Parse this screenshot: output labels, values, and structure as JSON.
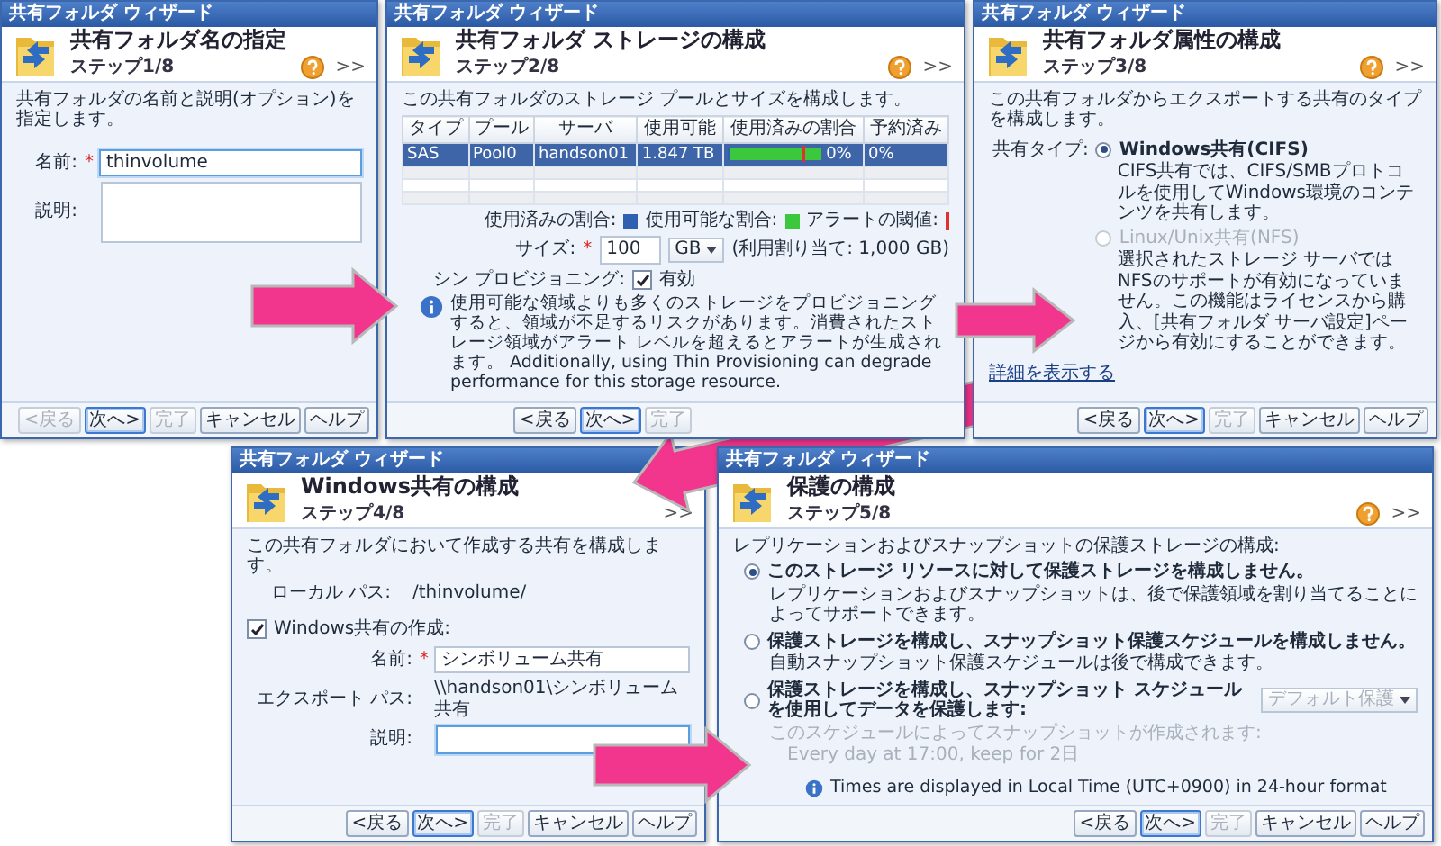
{
  "windows": [
    {
      "kind": "name",
      "title_bar": "共有フォルダ ウィザード",
      "heading": "共有フォルダ名の指定",
      "step": "ステップ1/8",
      "help_icon": true,
      "expand": ">>",
      "description": "共有フォルダの名前と説明(オプション)を指定します。",
      "rows": [
        {
          "kind": "input",
          "label": "名前:",
          "marker": "*",
          "value": "thinvolume",
          "focused": true
        },
        {
          "kind": "area",
          "label": "説明:",
          "focused": false
        }
      ],
      "buttons": [
        {
          "label": "<戻る",
          "disabled": true,
          "default": false
        },
        {
          "label": "次へ>",
          "disabled": false,
          "default": true
        },
        {
          "label": "完了",
          "disabled": true,
          "default": false
        },
        {
          "label": "キャンセル",
          "disabled": false,
          "default": false
        },
        {
          "label": "ヘルプ",
          "disabled": false,
          "default": false
        }
      ]
    },
    {
      "kind": "storage",
      "title_bar": "共有フォルダ ウィザード",
      "heading": "共有フォルダ ストレージの構成",
      "step": "ステップ2/8",
      "help_icon": true,
      "expand": ">>",
      "description": "この共有フォルダのストレージ プールとサイズを構成します。",
      "table": {
        "columns": [
          "タイプ",
          "プール",
          "サーバ",
          "使用可能",
          "使用済みの割合",
          "予約済み"
        ],
        "rows": [
          {
            "selected": true,
            "type": "SAS",
            "pool": "Pool0",
            "server": "handson01",
            "available": "1.847 TB",
            "level": 0,
            "used": "0%",
            "reserved": "0%"
          }
        ]
      },
      "legend": [
        {
          "label": "使用済みの割合:",
          "kind": "square",
          "color": "#2f5fb0"
        },
        {
          "label": "使用可能な割合:",
          "kind": "square",
          "color": "#3cc83c"
        },
        {
          "label": "アラートの閾値:",
          "kind": "line",
          "color": "#e03030"
        }
      ],
      "size": {
        "label": "サイズ:",
        "marker": "*",
        "value": "100",
        "unit": "GB",
        "note": "(利用割り当て: 1,000 GB)"
      },
      "thin": {
        "label": "シン プロビジョニング:",
        "checked": true,
        "option": "有効"
      },
      "info": "使用可能な領域よりも多くのストレージをプロビジョニングすると、領域が不足するリスクがあります。消費されたストレージ領域がアラート レベルを超えるとアラートが生成されます。 Additionally, using Thin Provisioning can degrade performance for this storage resource.",
      "buttons": [
        {
          "label": "<戻る",
          "disabled": false,
          "default": false
        },
        {
          "label": "次へ>",
          "disabled": false,
          "default": true
        },
        {
          "label": "完了",
          "disabled": true,
          "default": false
        }
      ]
    },
    {
      "kind": "protocol",
      "title_bar": "共有フォルダ ウィザード",
      "heading": "共有フォルダ属性の構成",
      "step": "ステップ3/8",
      "help_icon": true,
      "expand": ">>",
      "description": "この共有フォルダからエクスポートする共有のタイプを構成します。",
      "type_label": "共有タイプ:",
      "options": [
        {
          "label": "Windows共有(CIFS)",
          "selected": true,
          "disabled": false,
          "note": "CIFS共有では、CIFS/SMBプロトコルを使用してWindows環境のコンテンツを共有します。"
        },
        {
          "label": "Linux/Unix共有(NFS)",
          "selected": false,
          "disabled": true,
          "note": "選択されたストレージ サーバではNFSのサポートが有効になっていません。この機能はライセンスから購入、[共有フォルダ サーバ設定]ページから有効にすることができます。"
        }
      ],
      "link": "詳細を表示する",
      "buttons": [
        {
          "label": "<戻る",
          "disabled": false,
          "default": false
        },
        {
          "label": "次へ>",
          "disabled": false,
          "default": true
        },
        {
          "label": "完了",
          "disabled": true,
          "default": false
        },
        {
          "label": "キャンセル",
          "disabled": false,
          "default": false
        },
        {
          "label": "ヘルプ",
          "disabled": false,
          "default": false
        }
      ]
    },
    {
      "kind": "cifs",
      "title_bar": "共有フォルダ ウィザード",
      "heading": "Windows共有の構成",
      "step": "ステップ4/8",
      "help_icon": false,
      "expand": ">>",
      "description": "この共有フォルダにおいて作成する共有を構成します。",
      "path_rows": [
        {
          "kind": "text",
          "label": "ローカル パス:",
          "value": "/thinvolume/"
        }
      ],
      "create_share": {
        "label": "Windows共有の作成:",
        "checked": true
      },
      "rows": [
        {
          "kind": "input",
          "label": "名前:",
          "marker": "*",
          "value": "シンボリューム共有",
          "focused": false
        },
        {
          "kind": "text",
          "label": "エクスポート パス:",
          "value": "\\\\handson01\\シンボリューム共有"
        },
        {
          "kind": "input",
          "label": "説明:",
          "focused": true
        }
      ],
      "buttons": [
        {
          "label": "<戻る",
          "disabled": false,
          "default": false
        },
        {
          "label": "次へ>",
          "disabled": false,
          "default": true
        },
        {
          "label": "完了",
          "disabled": true,
          "default": false
        },
        {
          "label": "キャンセル",
          "disabled": false,
          "default": false
        },
        {
          "label": "ヘルプ",
          "disabled": false,
          "default": false
        }
      ]
    },
    {
      "kind": "protection",
      "title_bar": "共有フォルダ ウィザード",
      "heading": "保護の構成",
      "step": "ステップ5/8",
      "help_icon": true,
      "expand": ">>",
      "description": "レプリケーションおよびスナップショットの保護ストレージの構成:",
      "options": [
        {
          "label": "このストレージ リソースに対して保護ストレージを構成しません。",
          "selected": true,
          "notes": [
            "レプリケーションおよびスナップショットは、後で保護領域を割り当てることによってサポートできます。"
          ],
          "notes_disabled": false
        },
        {
          "label": "保護ストレージを構成し、スナップショット保護スケジュールを構成しません。",
          "selected": false,
          "notes": [
            "自動スナップショット保護スケジュールは後で構成できます。"
          ],
          "notes_disabled": false
        },
        {
          "label": "保護ストレージを構成し、スナップショット スケジュールを使用してデータを保護します:",
          "selected": false,
          "dropdown": {
            "value": "デフォルト保護",
            "disabled": true
          },
          "notes": [
            "このスケジュールによってスナップショットが作成されます:",
            "Every day at 17:00, keep for 2日"
          ],
          "notes_disabled": true
        }
      ],
      "note": "Times are displayed in Local Time (UTC+0900) in 24-hour format",
      "buttons": [
        {
          "label": "<戻る",
          "disabled": false,
          "default": false
        },
        {
          "label": "次へ>",
          "disabled": false,
          "default": true
        },
        {
          "label": "完了",
          "disabled": true,
          "default": false
        },
        {
          "label": "キャンセル",
          "disabled": false,
          "default": false
        },
        {
          "label": "ヘルプ",
          "disabled": false,
          "default": false
        }
      ]
    }
  ]
}
